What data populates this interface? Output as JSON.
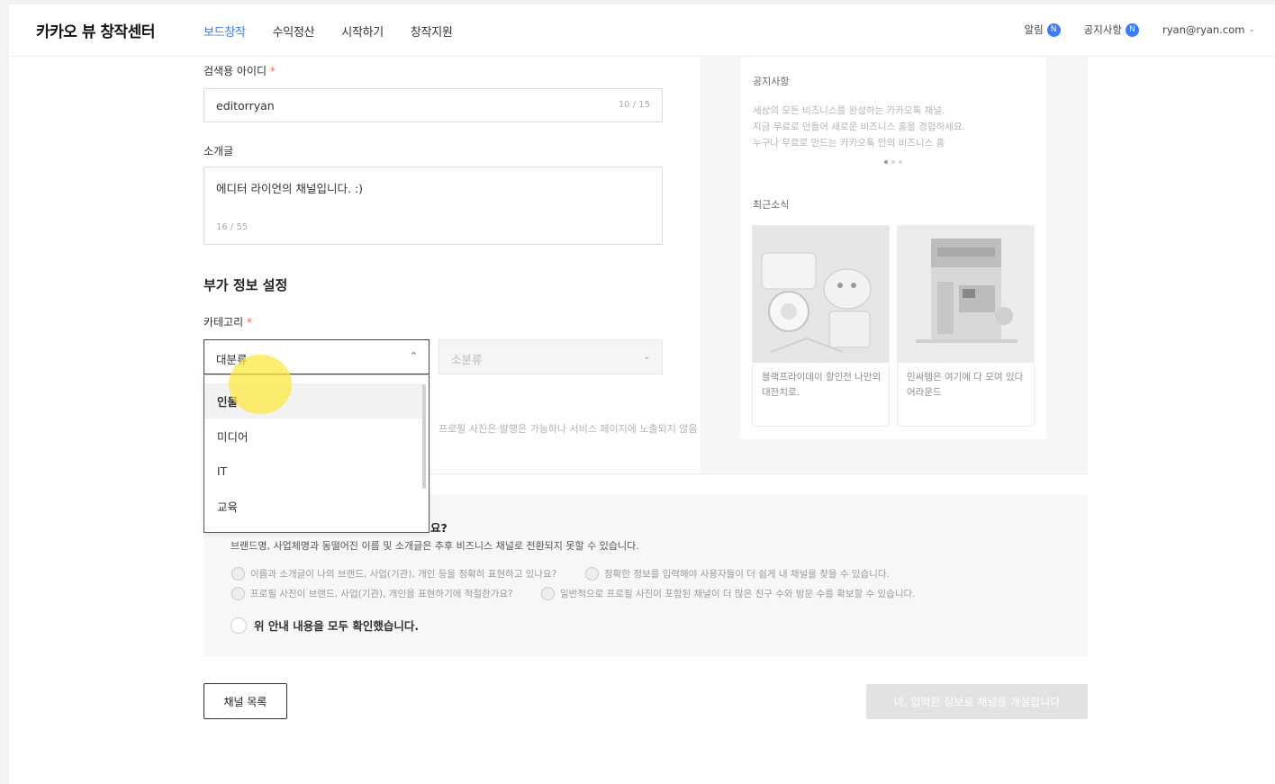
{
  "header": {
    "logo": "카카오 뷰 창작센터",
    "nav": [
      "보드창작",
      "수익정산",
      "시작하기",
      "창작지원"
    ],
    "alerts_label": "알림",
    "alerts_badge": "N",
    "notice_label": "공지사항",
    "notice_badge": "N",
    "account": "ryan@ryan.com"
  },
  "form": {
    "search_id_label": "검색용 아이디",
    "search_id_value": "editorryan",
    "search_id_counter": "10 / 15",
    "intro_label": "소개글",
    "intro_value": "에디터 라이언의 채널입니다. :)",
    "intro_counter": "16 / 55",
    "extra_section_title": "부가 정보 설정",
    "category_label": "카테고리",
    "major_placeholder": "대분류",
    "minor_placeholder": "소분류",
    "hidden_hint": "프로필 사진은 발행은 가능하나 서비스 페이지에 노출되지 않음"
  },
  "dropdown": {
    "options": [
      "인물",
      "미디어",
      "IT",
      "교육"
    ],
    "highlighted": "인물"
  },
  "sidebar": {
    "notice_title": "공지사항",
    "notice_lines": [
      "세상의 모든 비즈니스를 완성하는 카카오톡 채널.",
      "지금 무료로 만들어 새로운 비즈니스 홈을 경험하세요.",
      "누구나 무료로 만드는 카카오톡 안의 비즈니스 홈"
    ],
    "news_title": "최근소식",
    "news": [
      {
        "text": "블랙프라이데이 할인전 나만의 대잔치로."
      },
      {
        "text": "인싸템은 여기에 다 모여 있다 어라운드"
      }
    ]
  },
  "info": {
    "heading": "요?",
    "subtitle": "브랜드명, 사업체명과 동떨어진 이름 및 소개글은 추후 비즈니스 채널로 전환되지 못할 수 있습니다.",
    "checks": [
      "이름과 소개글이 나의 브랜드, 사업(기관), 개인 등을 정확히 표현하고 있나요?",
      "정확한 정보를 입력해야 사용자들이 더 쉽게 내 채널을 찾을 수 있습니다.",
      "프로필 사진이 브랜드, 사업(기관), 개인을 표현하기에 적절한가요?",
      "일반적으로 프로필 사진이 포함된 채널이 더 많은 친구 수와 방문 수를 확보할 수 있습니다."
    ],
    "confirm": "위 안내 내용을 모두 확인했습니다."
  },
  "buttons": {
    "list": "채널 목록",
    "submit": "네, 입력한 정보로 채널을 개설합니다"
  },
  "colors": {
    "accent": "#3b7bff",
    "required": "#ff5a4f",
    "cursor": "#fce83c"
  }
}
